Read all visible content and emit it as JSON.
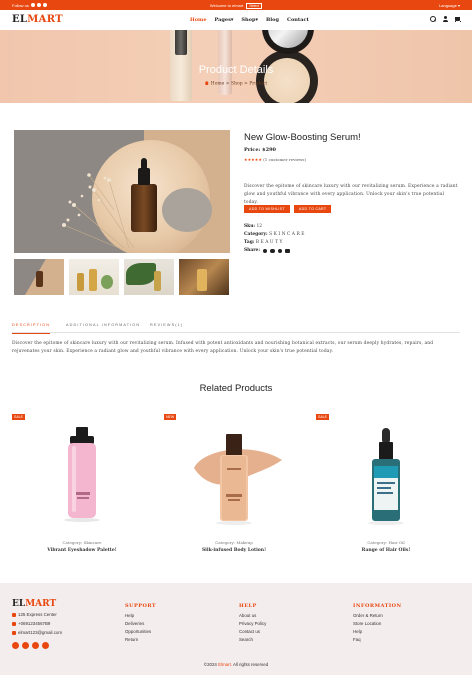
{
  "topbar": {
    "follow_label": "Follow us",
    "welcome_text": "Welcome to elmart",
    "currency": "Select",
    "language": "Language"
  },
  "header": {
    "logo_part1": "EL",
    "logo_part2": "MART",
    "nav": [
      {
        "label": "Home"
      },
      {
        "label": "Pages"
      },
      {
        "label": "Shop"
      },
      {
        "label": "Blog"
      },
      {
        "label": "Contact"
      }
    ]
  },
  "hero": {
    "title": "Product Details",
    "breadcrumb": [
      "Home",
      "Shop",
      "Product"
    ]
  },
  "product": {
    "name": "New Glow-Boosting Serum!",
    "price_label": "Price:",
    "price_value": "$290",
    "stars": "★★★★★",
    "reviews": "(1 customer reviews)",
    "description": "Discover the epitome of skincare luxury with our revitalizing serum. Experience a radiant glow and youthful vibrance with every application. Unlock your skin's true potential today.",
    "add_to_wishlist": "ADD TO WISHLIST",
    "add_to_cart": "ADD TO CART",
    "sku_label": "Sku:",
    "sku_value": "12",
    "category_label": "Category:",
    "category_value": "SKINCARE",
    "tag_label": "Tag:",
    "tag_value": "BEAUTY",
    "share_label": "Share:"
  },
  "tabs": [
    {
      "label": "DESCRIPTION",
      "active": true
    },
    {
      "label": "ADDITIONAL INFORMATION",
      "active": false
    },
    {
      "label": "REVIEWS(1)",
      "active": false
    }
  ],
  "tab_content": "Discover the epitome of skincare luxury with our revitalizing serum. Infused with potent antioxidants and nourishing botanical extracts, our serum deeply hydrates, repairs, and rejuvenates your skin. Experience a radiant glow and youthful vibrance with every application. Unlock your skin's true potential today.",
  "related": {
    "title": "Related Products",
    "items": [
      {
        "badge": "SALE",
        "category": "Category: Skincare",
        "name": "Vibrant Eyeshadow Palette!"
      },
      {
        "badge": "NEW",
        "category": "Category: Makeup",
        "name": "Silk-infused Body Lotion!"
      },
      {
        "badge": "SALE",
        "category": "Category: Hair Oil",
        "name": "Range of Hair Oils!"
      }
    ]
  },
  "footer": {
    "logo_part1": "EL",
    "logo_part2": "MART",
    "address": "125 Express Center",
    "phone": "+0691234567B9",
    "email": "elmart123@gmail.com",
    "columns": [
      {
        "title": "SUPPORT",
        "links": [
          "Help",
          "Deliveries",
          "Opportunities",
          "Return"
        ]
      },
      {
        "title": "HELP",
        "links": [
          "About us",
          "Privacy Policy",
          "Contact us",
          "Search"
        ]
      },
      {
        "title": "INFORMATION",
        "links": [
          "Order & Return",
          "Store Location",
          "Help",
          "Faq"
        ]
      }
    ],
    "copyright_prefix": "©2024",
    "copyright_brand": "Elmart.",
    "copyright_suffix": "All rights reserved"
  }
}
